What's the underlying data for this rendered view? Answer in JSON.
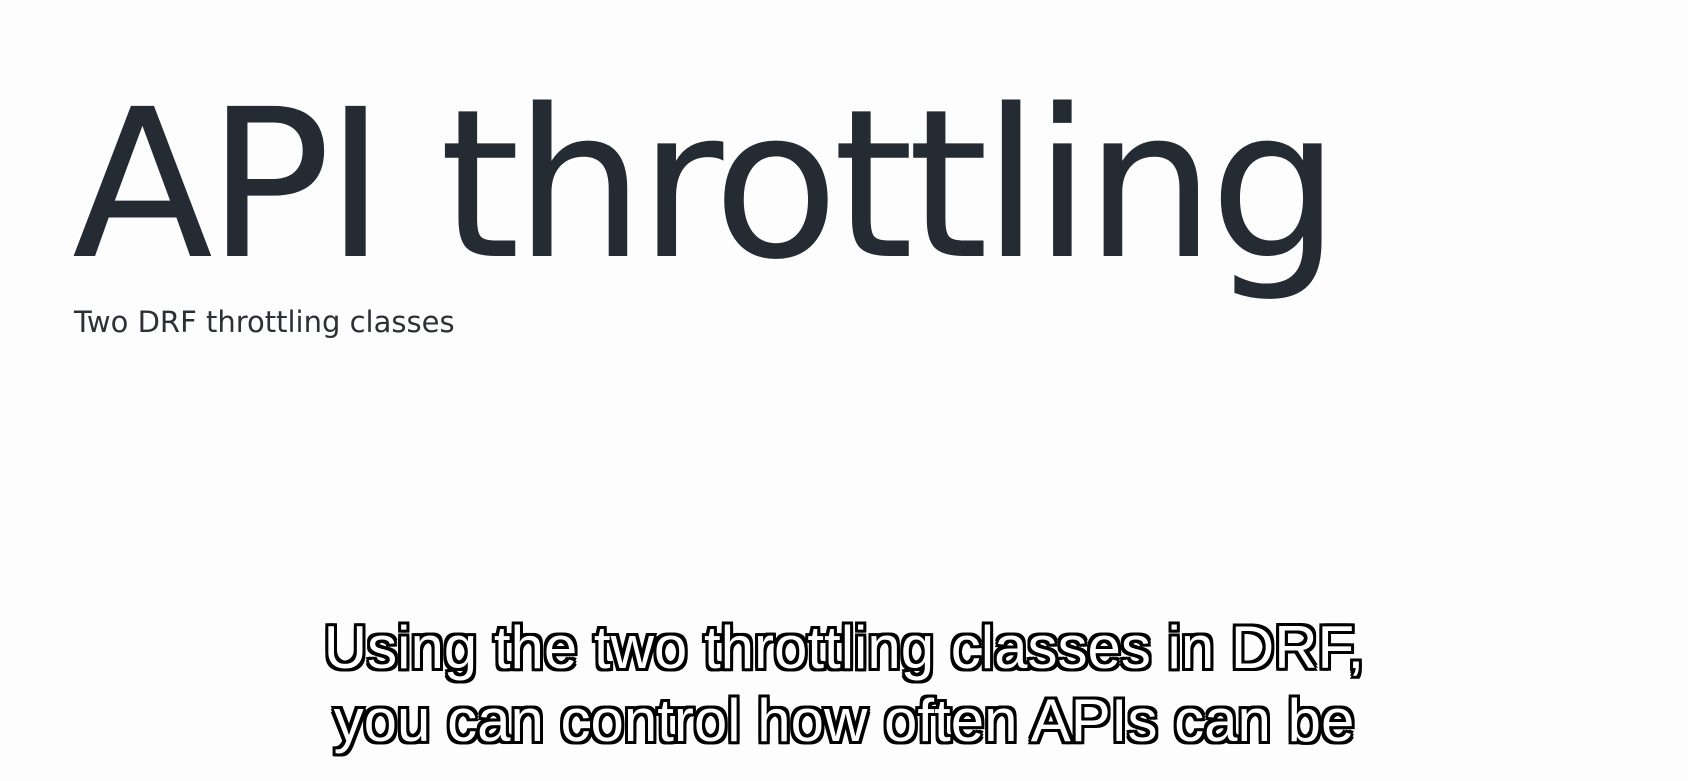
{
  "slide": {
    "title": "API throttling",
    "subtitle": "Two DRF throttling classes"
  },
  "caption": {
    "lines": [
      "Using the two throttling classes in DRF,",
      "you can control how often APIs can be"
    ]
  },
  "colors": {
    "background": "#fdfdfd",
    "title_text": "#242b33",
    "subtitle_text": "#2d3035",
    "caption_fill": "#ffffff",
    "caption_outline": "#000000"
  }
}
